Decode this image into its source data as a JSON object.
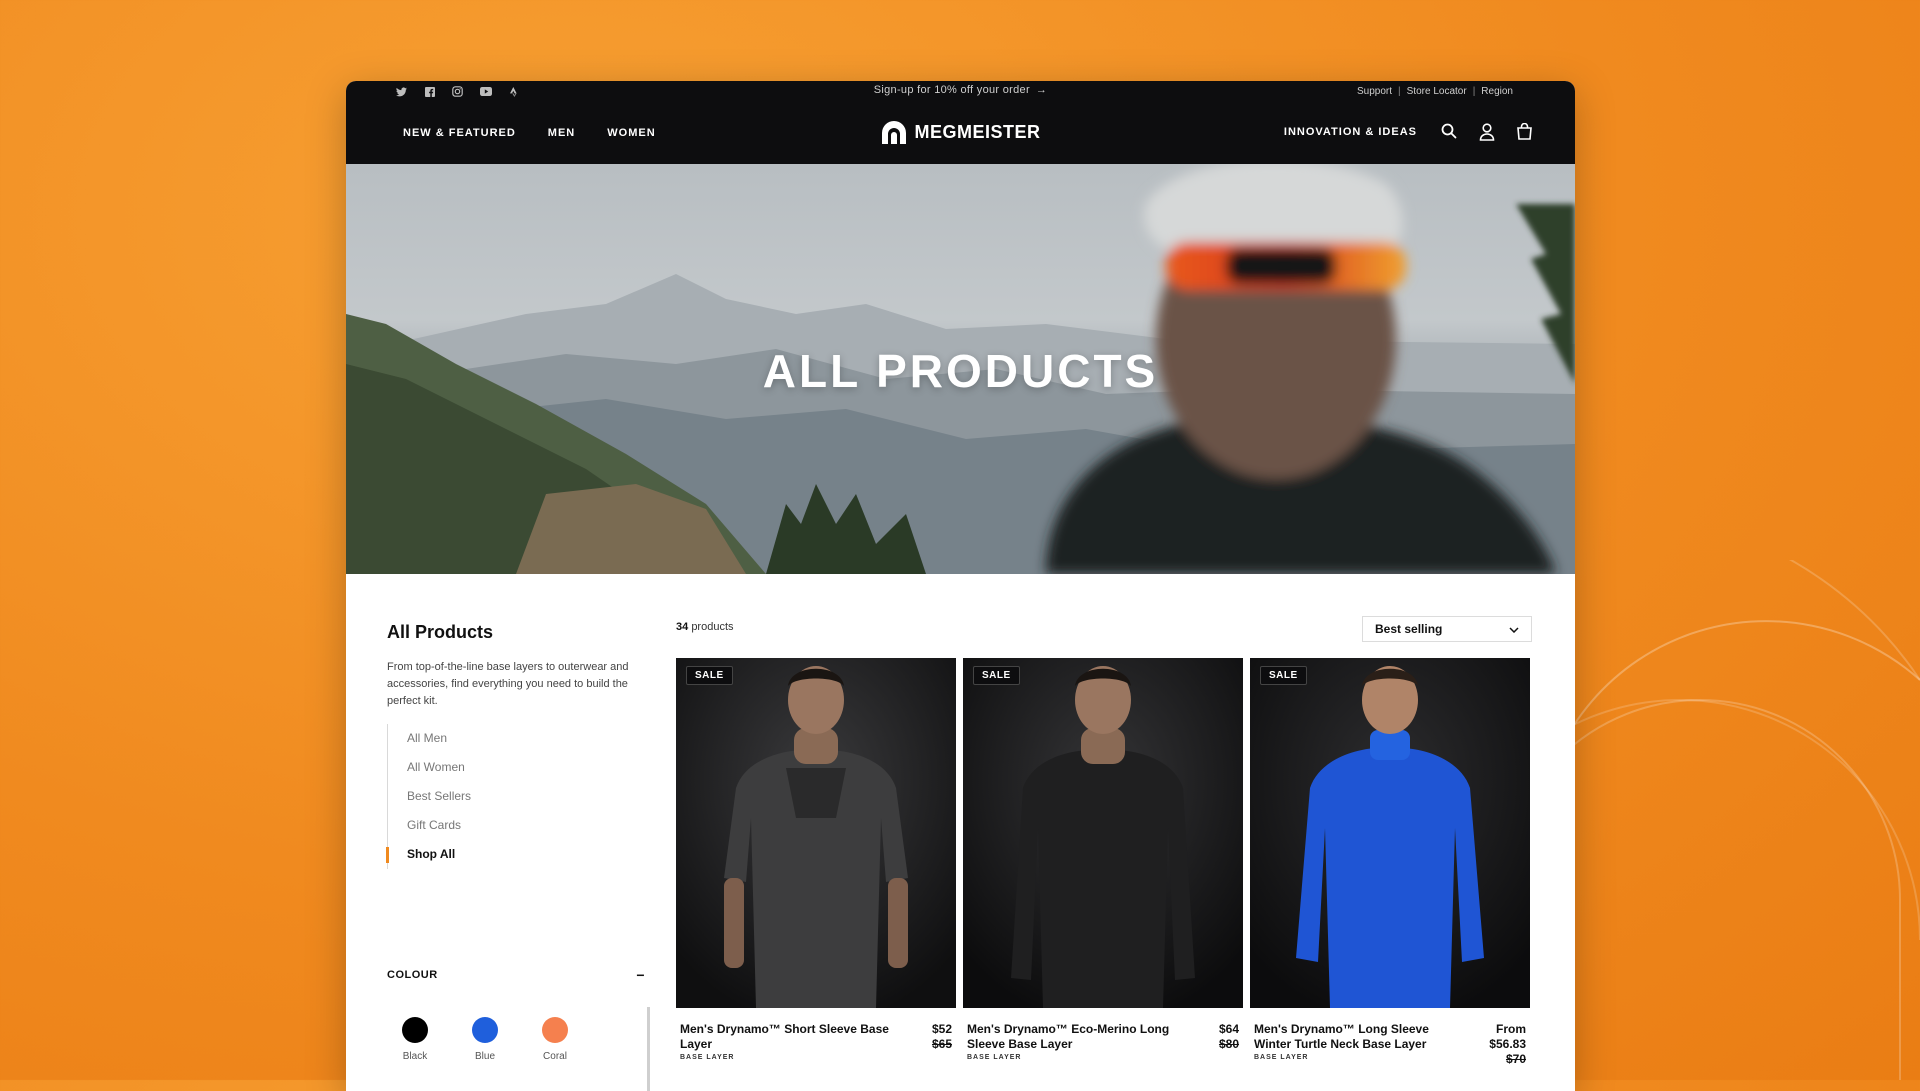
{
  "topbar": {
    "promo": "Sign-up for 10% off your order",
    "links": [
      "Support",
      "Store Locator",
      "Region"
    ]
  },
  "nav": {
    "left": [
      "NEW & FEATURED",
      "MEN",
      "WOMEN"
    ],
    "brand": "MEGMEISTER",
    "right_label": "INNOVATION & IDEAS",
    "icons": [
      "search-icon",
      "account-icon",
      "cart-icon"
    ]
  },
  "hero": {
    "title": "ALL PRODUCTS"
  },
  "sidebar": {
    "title": "All Products",
    "description": "From top-of-the-line base layers to outerwear and accessories, find everything you need to build the perfect kit.",
    "categories": [
      "All Men",
      "All Women",
      "Best Sellers",
      "Gift Cards",
      "Shop All"
    ],
    "active_category": "Shop All",
    "colour_heading": "COLOUR",
    "colours": [
      {
        "label": "Black",
        "color": "#000000"
      },
      {
        "label": "Blue",
        "color": "#1f5fdc"
      },
      {
        "label": "Coral",
        "color": "#f5804e"
      }
    ]
  },
  "listing": {
    "count": "34",
    "count_label": "products",
    "sort": "Best selling",
    "products": [
      {
        "badge": "SALE",
        "name": "Men's Drynamo™ Short Sleeve Base Layer",
        "category": "BASE LAYER",
        "price": "$52",
        "old_price": "$65",
        "prefix": ""
      },
      {
        "badge": "SALE",
        "name": "Men's Drynamo™ Eco-Merino Long Sleeve Base Layer",
        "category": "BASE LAYER",
        "price": "$64",
        "old_price": "$80",
        "prefix": ""
      },
      {
        "badge": "SALE",
        "name": "Men's Drynamo™ Long Sleeve Winter Turtle Neck Base Layer",
        "category": "BASE LAYER",
        "price": "$56.83",
        "old_price": "$70",
        "prefix": "From"
      }
    ]
  },
  "colors": {
    "accent": "#f08a1f",
    "nav_bg": "#0d0d0f",
    "background": "#f08a1f"
  }
}
